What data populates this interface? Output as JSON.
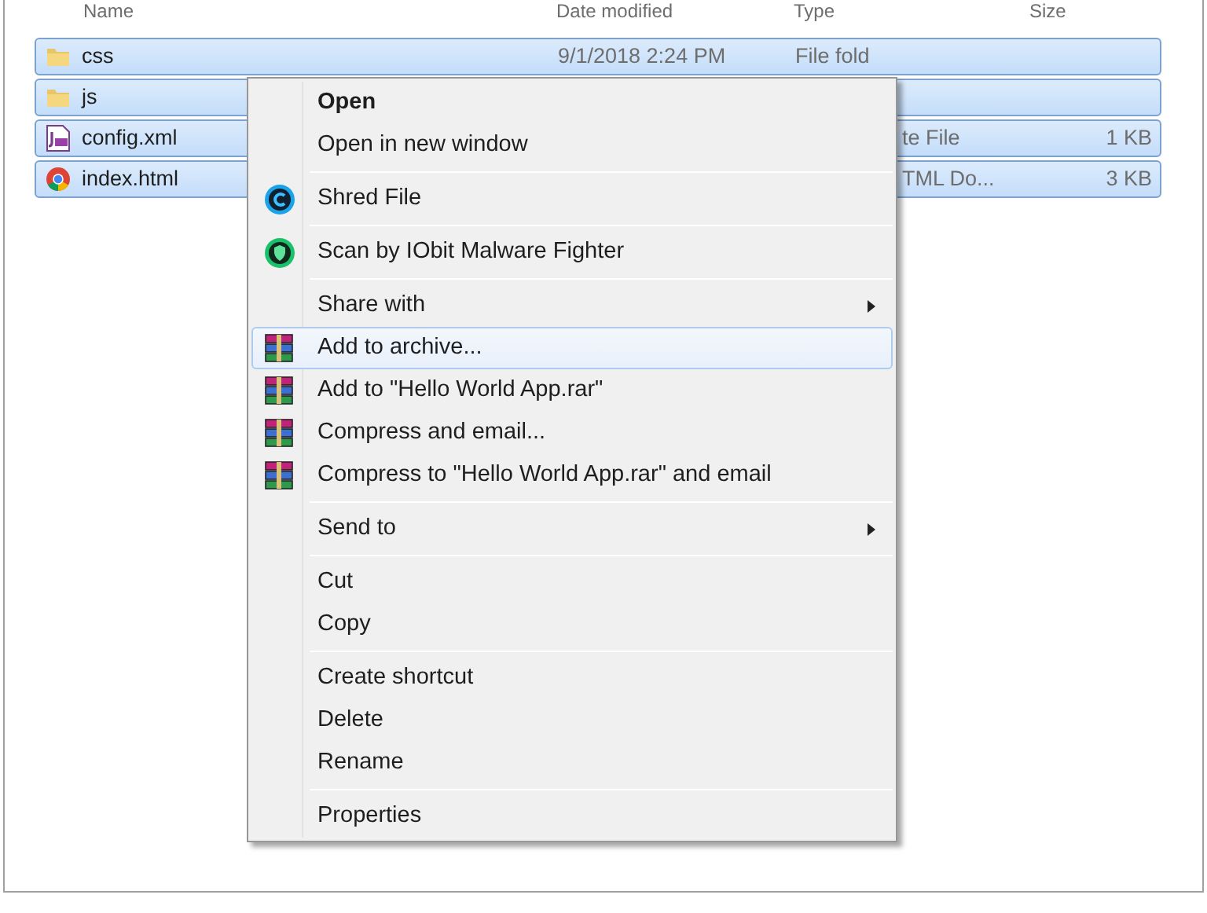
{
  "columns": [
    {
      "label": "Name"
    },
    {
      "label": "Date modified"
    },
    {
      "label": "Type"
    },
    {
      "label": "Size"
    }
  ],
  "files": [
    {
      "kind": "folder",
      "name": "css",
      "date": "9/1/2018 2:24 PM",
      "type": "File fold",
      "selected": true
    },
    {
      "kind": "folder",
      "name": "js",
      "selected": true
    },
    {
      "kind": "jsf",
      "name": "config.xml",
      "type": "te File",
      "size": "1 KB",
      "selected": true,
      "covered": true
    },
    {
      "kind": "browser",
      "name": "index.html",
      "type": "TML Do...",
      "size": "3 KB",
      "selected": true,
      "covered": true
    }
  ],
  "context_menu": [
    {
      "kind": "plain",
      "label": "Open",
      "bold": true,
      "selected": false
    },
    {
      "kind": "plain",
      "label": "Open in new window",
      "selected": false
    },
    {
      "kind": "separator"
    },
    {
      "kind": "shred",
      "label": "Shred File",
      "selected": false
    },
    {
      "kind": "separator"
    },
    {
      "kind": "shield",
      "label": "Scan by IObit Malware Fighter",
      "selected": false
    },
    {
      "kind": "separator"
    },
    {
      "kind": "plain",
      "label": "Share with",
      "submenu": true,
      "selected": false
    },
    {
      "kind": "archive",
      "label": "Add to archive...",
      "selected": true
    },
    {
      "kind": "archive",
      "label": "Add to \"Hello World App.rar\"",
      "selected": false
    },
    {
      "kind": "archive",
      "label": "Compress and email...",
      "selected": false
    },
    {
      "kind": "archive",
      "label": "Compress to \"Hello World App.rar\" and email",
      "selected": false
    },
    {
      "kind": "separator"
    },
    {
      "kind": "plain",
      "label": "Send to",
      "submenu": true,
      "selected": false
    },
    {
      "kind": "separator"
    },
    {
      "kind": "plain",
      "label": "Cut",
      "selected": false
    },
    {
      "kind": "plain",
      "label": "Copy",
      "selected": false
    },
    {
      "kind": "separator"
    },
    {
      "kind": "plain",
      "label": "Create shortcut",
      "selected": false
    },
    {
      "kind": "plain",
      "label": "Delete",
      "selected": false
    },
    {
      "kind": "plain",
      "label": "Rename",
      "selected": false
    },
    {
      "kind": "separator"
    },
    {
      "kind": "plain",
      "label": "Properties",
      "selected": false
    }
  ]
}
